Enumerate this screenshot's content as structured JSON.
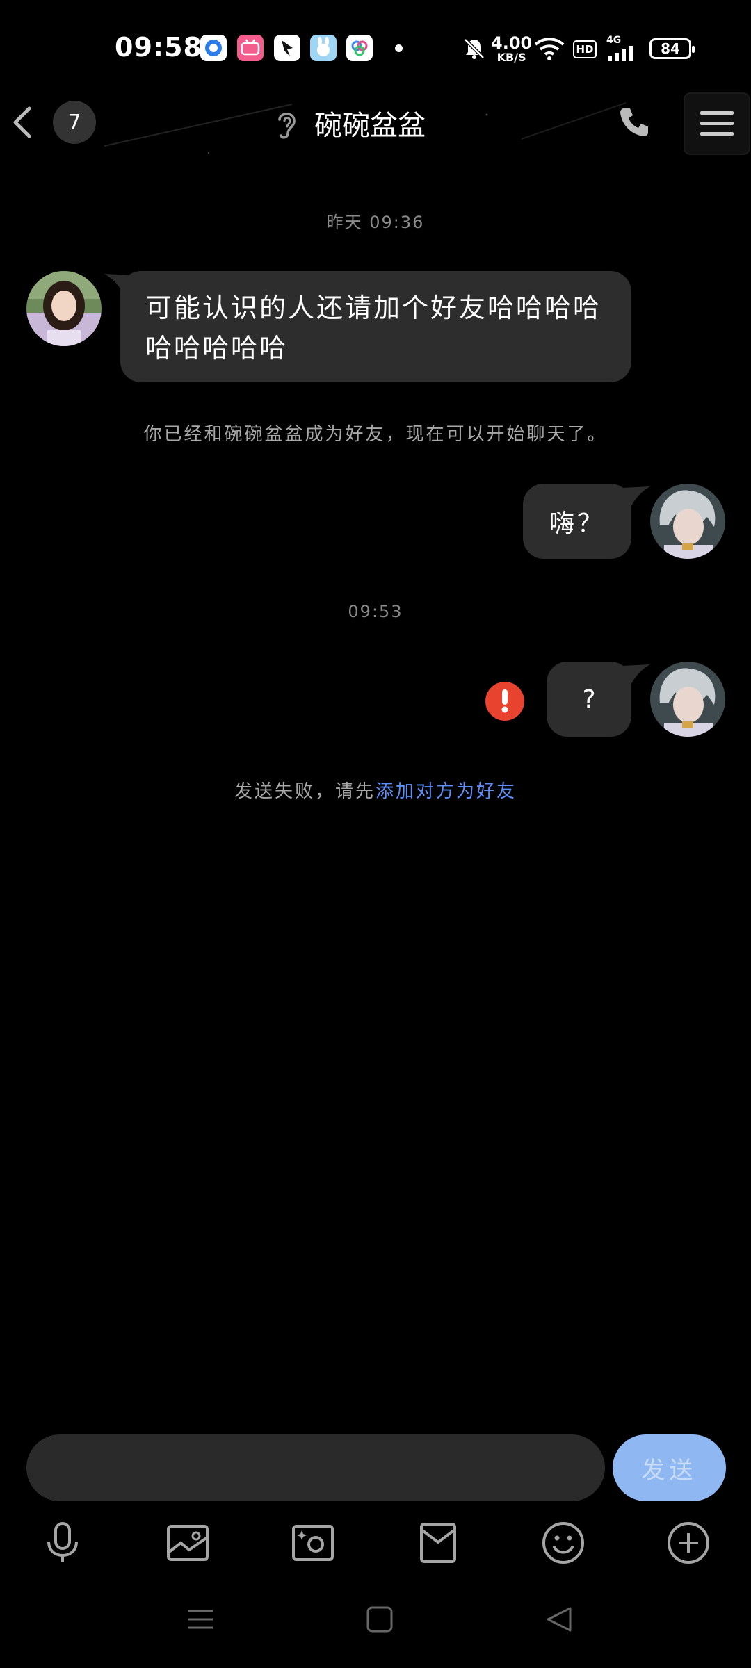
{
  "status_bar": {
    "time": "09:58",
    "net_speed_value": "4.00",
    "net_speed_unit": "KB/S",
    "network_type": "4G",
    "hd_label": "HD",
    "battery": "84"
  },
  "header": {
    "unread_count": "7",
    "title": "碗碗盆盆"
  },
  "messages": {
    "timestamp_1": "昨天 09:36",
    "incoming_1": "可能认识的人还请加个好友哈哈哈哈哈哈哈哈哈",
    "system_1": "你已经和碗碗盆盆成为好友，现在可以开始聊天了。",
    "outgoing_1": "嗨？",
    "timestamp_2": "09:53",
    "outgoing_2": "?",
    "failure_prefix": "发送失败，请先",
    "failure_link": "添加对方为好友"
  },
  "input": {
    "value": "",
    "send_label": "发送"
  },
  "toolbar": {
    "icons": [
      "microphone-icon",
      "image-icon",
      "camera-icon",
      "red-packet-icon",
      "emoji-icon",
      "plus-icon"
    ]
  },
  "nav": {
    "icons": [
      "recent-apps-icon",
      "home-icon",
      "back-icon"
    ]
  },
  "colors": {
    "background": "#000000",
    "bubble": "#2d2d2d",
    "link": "#5b8ff9",
    "send_button": "#8fb8f3",
    "error": "#e8432f"
  }
}
